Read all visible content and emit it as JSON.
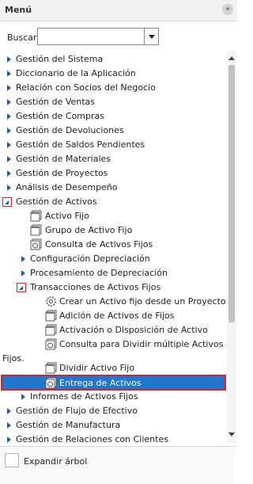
{
  "header": {
    "title": "Menú",
    "collapse_icon": "«"
  },
  "search": {
    "label": "Buscar:",
    "value": ""
  },
  "tree": [
    "Gestión del Sistema",
    "Diccionario de la Aplicación",
    "Relación con Socios del Negocio",
    "Gestión de Ventas",
    "Gestión de Compras",
    "Gestión de Devoluciones",
    "Gestión de Saldos Pendientes",
    "Gestión de Materiales",
    "Gestión de Proyectos",
    "Análisis de Desempeño",
    "Gestión de Activos",
    "Activo Fijo",
    "Grupo de Activo Fijo",
    "Consulta de Activos Fijos",
    "Configuración Depreciación",
    "Procesamiento de Depreciación",
    "Transacciones de Activos Fijos",
    "Crear un Activo fijo desde un Proyecto",
    "Adición de Activos de Fijos",
    "Activación o Disposición de Activo",
    "Consulta para Dividir múltiple Activos",
    "Fijos.",
    "Dividir Activo Fijo",
    "Entrega de Activos",
    "Informes de Activos Fijos",
    "Gestión de Flujo de Efectivo",
    "Gestión de Manufactura",
    "Gestión de Relaciones con Clientes"
  ],
  "footer": {
    "expand_label": "Expandir árbol"
  }
}
